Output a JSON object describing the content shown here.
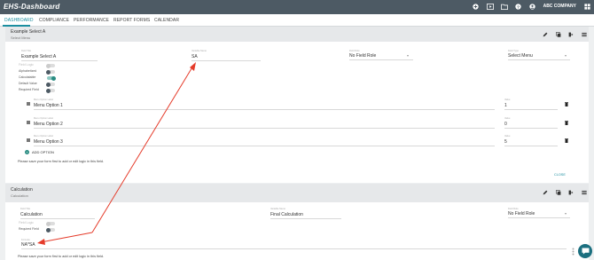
{
  "app": {
    "logo": "EHS-Dashboard",
    "company": "ABC COMPANY"
  },
  "nav": {
    "tabs": [
      "DASHBOARD",
      "COMPLIANCE",
      "PERFORMANCE",
      "REPORT FORMS",
      "CALENDAR"
    ]
  },
  "select_panel": {
    "title": "Example Select A",
    "subtitle": "Select Menu",
    "fields": {
      "field_title": {
        "label": "Field Title",
        "value": "Example Select A"
      },
      "variable_name": {
        "label": "Variable Name",
        "value": "SA"
      },
      "field_role": {
        "label": "Field Role",
        "value": "No Field Role"
      },
      "field_type": {
        "label": "Field Type",
        "value": "Select Menu"
      }
    },
    "toggles": [
      {
        "label": "Field Logic",
        "state": "off"
      },
      {
        "label": "Alphabetized",
        "state": "half"
      },
      {
        "label": "Calculatable",
        "state": "on"
      },
      {
        "label": "Default Value",
        "state": "half"
      },
      {
        "label": "Required Field",
        "state": "half"
      }
    ],
    "options": [
      {
        "label_caption": "Menu Option Label",
        "label": "Menu Option 1",
        "value_caption": "Value",
        "value": "1"
      },
      {
        "label_caption": "Menu Option Label",
        "label": "Menu Option 2",
        "value_caption": "Value",
        "value": "0"
      },
      {
        "label_caption": "Menu Option Label",
        "label": "Menu Option 3",
        "value_caption": "Value",
        "value": "5"
      }
    ],
    "add_option": "ADD OPTION",
    "note": "Please save your form first to add or edit logic in this field.",
    "close": "CLOSE"
  },
  "calc_panel": {
    "title": "Calculation",
    "subtitle": "Calculation",
    "fields": {
      "field_title": {
        "label": "Field Title",
        "value": "Calculation"
      },
      "variable_name": {
        "label": "Variable Name",
        "value": "Final Calculation"
      },
      "field_role": {
        "label": "Field Role",
        "value": "No Field Role"
      }
    },
    "toggles": [
      {
        "label": "Field Logic",
        "state": "off"
      },
      {
        "label": "Required Field",
        "state": "half"
      }
    ],
    "formula": {
      "label": "Formula",
      "value": "NA*SA"
    },
    "note": "Please save your form first to add or edit logic in this field."
  },
  "colors": {
    "topbar": "#4d5a64",
    "accent": "#1b8ea0",
    "toggle_on": "#2a8c82",
    "annotation_arrow": "#e53b2a"
  }
}
